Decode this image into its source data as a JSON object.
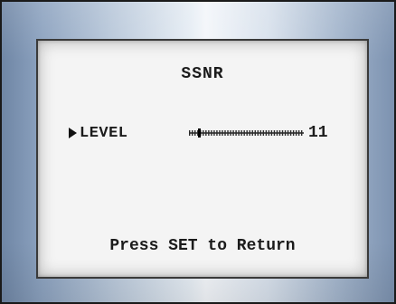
{
  "menu": {
    "title": "SSNR",
    "items": [
      {
        "label": "LEVEL",
        "value": "11",
        "level_fraction": 0.08,
        "selected": true
      }
    ],
    "footer": "Press SET to Return"
  },
  "colors": {
    "screen_bg": "#f4f4f4",
    "text": "#1b1b1b",
    "bezel_light": "#f3f6fa",
    "bezel_dark": "#6f86a5"
  },
  "icons": {
    "cursor": "triangle-right-icon"
  }
}
